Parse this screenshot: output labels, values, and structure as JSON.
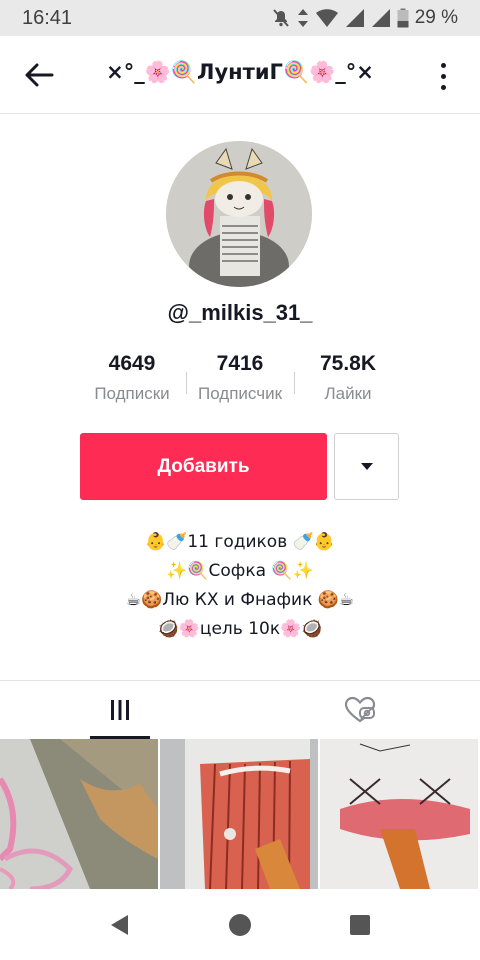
{
  "status_bar": {
    "time": "16:41",
    "battery": "29 %"
  },
  "header": {
    "title": "×°_🌸🍭ЛунтиГ🍭🌸_°×"
  },
  "profile": {
    "username": "@_milkis_31_",
    "stats": [
      {
        "value": "4649",
        "label": "Подписки"
      },
      {
        "value": "7416",
        "label": "Подписчик"
      },
      {
        "value": "75.8K",
        "label": "Лайки"
      }
    ],
    "follow_label": "Добавить",
    "bio": [
      "👶🍼11 годиков 🍼👶",
      "✨🍭Софка 🍭✨",
      "☕🍪Лю КХ и Фнафик 🍪☕",
      "🥥🌸цель 10к🌸🥥"
    ]
  },
  "tabs": [
    {
      "icon": "grid-icon",
      "active": true
    },
    {
      "icon": "liked-videos-icon",
      "active": false
    }
  ],
  "videos": [
    {
      "name": "video-1"
    },
    {
      "name": "video-2"
    },
    {
      "name": "video-3"
    }
  ],
  "colors": {
    "accent": "#fe2c55",
    "text": "#161823",
    "muted": "#8a8b91"
  }
}
